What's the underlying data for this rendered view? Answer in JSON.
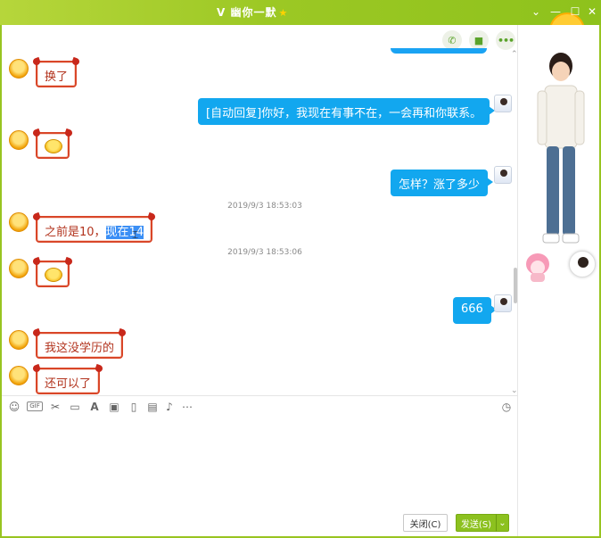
{
  "window": {
    "title": "V 幽你一默",
    "star_icon": "star-icon",
    "buttons": [
      "chevron-down-icon",
      "minimize-icon",
      "maximize-icon",
      "close-icon"
    ]
  },
  "top_actions": [
    "phone-icon",
    "video-icon",
    "more-icon"
  ],
  "messages": [
    {
      "side": "left",
      "text": "换了"
    },
    {
      "side": "right",
      "text": "[自动回复]你好，我现在有事不在，一会再和你联系。"
    },
    {
      "side": "left",
      "emoji": "smile-emoji"
    },
    {
      "side": "right",
      "text": "怎样？涨了多少"
    },
    {
      "timestamp": "2019/9/3 18:53:03"
    },
    {
      "side": "left",
      "text_plain": "之前是10，",
      "text_selected": "现在14"
    },
    {
      "timestamp": "2019/9/3 18:53:06"
    },
    {
      "side": "left",
      "emoji": "grin-emoji"
    },
    {
      "side": "right",
      "text": "666"
    },
    {
      "side": "left",
      "text": "我这没学历的"
    },
    {
      "side": "left",
      "text": "还可以了"
    }
  ],
  "toolbar": [
    "emoji-icon",
    "gif-icon",
    "scissors-icon",
    "folder-icon",
    "font-icon",
    "image-icon",
    "screen-share-icon",
    "file-icon",
    "music-icon",
    "more-icon",
    "history-icon"
  ],
  "toolbar_gif": "GIF",
  "buttons": {
    "close": "关闭(C)",
    "send": "发送(S)"
  },
  "colors": {
    "titlebar": "#9cc824",
    "bubble_right": "#12a7ef",
    "bubble_left_border": "#d94628",
    "send_button": "#8cc11f"
  }
}
